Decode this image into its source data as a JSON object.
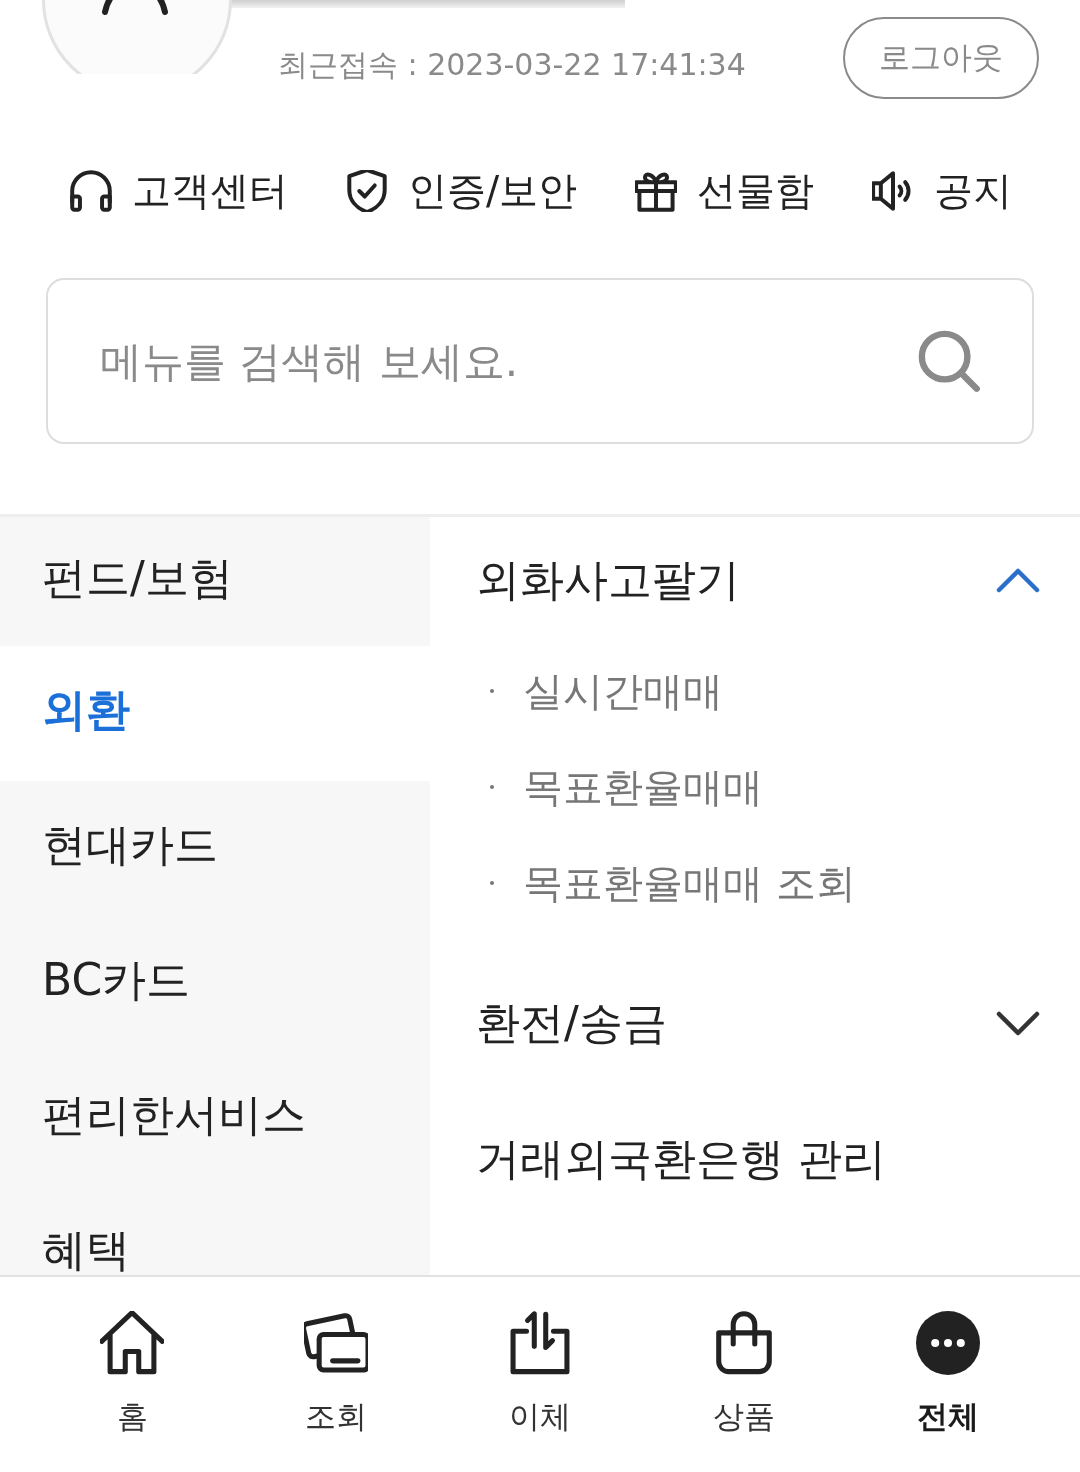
{
  "header": {
    "last_login": "최근접속 : 2023-03-22 17:41:34",
    "logout_button": "로그아웃"
  },
  "quick_links": [
    {
      "label": "고객센터"
    },
    {
      "label": "인증/보안"
    },
    {
      "label": "선물함"
    },
    {
      "label": "공지"
    }
  ],
  "search": {
    "placeholder": "메뉴를 검색해 보세요."
  },
  "categories": [
    {
      "label": "펀드/보험",
      "selected": false
    },
    {
      "label": "외환",
      "selected": true
    },
    {
      "label": "현대카드",
      "selected": false
    },
    {
      "label": "BC카드",
      "selected": false
    },
    {
      "label": "편리한서비스",
      "selected": false
    },
    {
      "label": "혜택",
      "selected": false
    }
  ],
  "submenu": [
    {
      "kind": "group",
      "label": "외화사고팔기",
      "expanded": true,
      "children": [
        {
          "label": "실시간매매"
        },
        {
          "label": "목표환율매매"
        },
        {
          "label": "목표환율매매 조회"
        }
      ]
    },
    {
      "kind": "group",
      "label": "환전/송금",
      "expanded": false
    },
    {
      "kind": "link",
      "label": "거래외국환은행 관리"
    }
  ],
  "bottom_nav": [
    {
      "label": "홈",
      "selected": false
    },
    {
      "label": "조회",
      "selected": false
    },
    {
      "label": "이체",
      "selected": false
    },
    {
      "label": "상품",
      "selected": false
    },
    {
      "label": "전체",
      "selected": true
    }
  ]
}
